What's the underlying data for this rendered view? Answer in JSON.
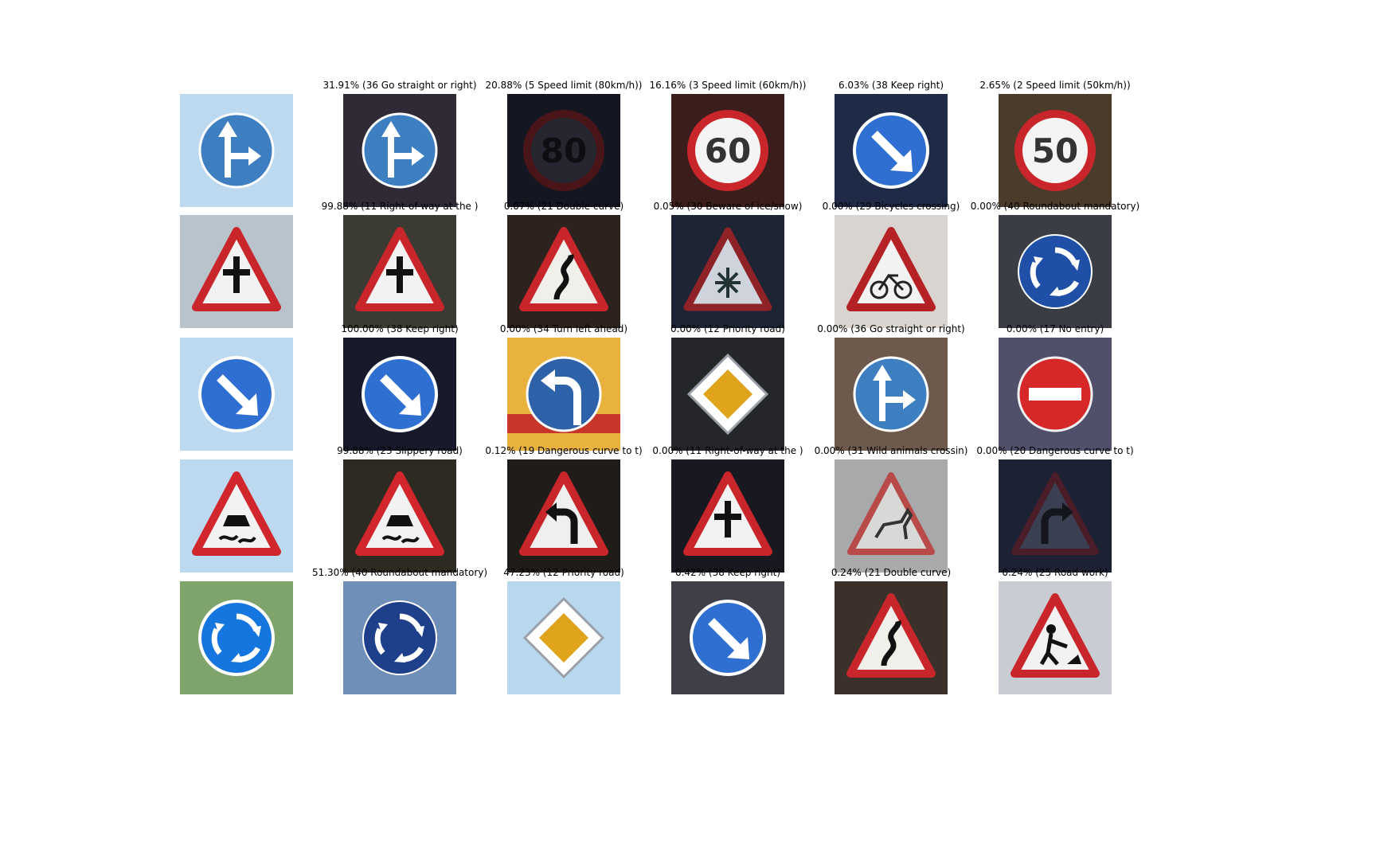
{
  "rows": [
    {
      "input": {
        "sign": "go-straight-or-right",
        "bg": "#bcd9f0",
        "style": "clean"
      },
      "preds": [
        {
          "label": "31.91% (36 Go straight or right)",
          "sign": "go-straight-or-right",
          "bg": "#2f2a35"
        },
        {
          "label": "20.88% (5 Speed limit (80km/h))",
          "sign": "speed-limit-dark",
          "text": "80",
          "bg": "#141621"
        },
        {
          "label": "16.16% (3 Speed limit (60km/h))",
          "sign": "speed-limit",
          "text": "60",
          "bg": "#3b1d1b"
        },
        {
          "label": "6.03% (38 Keep right)",
          "sign": "keep-right",
          "bg": "#1f2b46"
        },
        {
          "label": "2.65% (2 Speed limit (50km/h))",
          "sign": "speed-limit",
          "text": "50",
          "bg": "#4a3b2a"
        }
      ]
    },
    {
      "input": {
        "sign": "right-of-way",
        "bg": "#b9c3cc",
        "style": "clean"
      },
      "preds": [
        {
          "label": "99.88% (11 Right-of-way at the )",
          "sign": "right-of-way",
          "bg": "#3b3a33"
        },
        {
          "label": "0.07% (21 Double curve)",
          "sign": "double-curve",
          "bg": "#2d221d"
        },
        {
          "label": "0.05% (30 Beware of ice/snow)",
          "sign": "ice-snow",
          "bg": "#1d2433"
        },
        {
          "label": "0.00% (29 Bicycles crossing)",
          "sign": "bicycles",
          "bg": "#d9d4cf"
        },
        {
          "label": "0.00% (40 Roundabout mandatory)",
          "sign": "roundabout",
          "bg": "#3a3d44"
        }
      ]
    },
    {
      "input": {
        "sign": "keep-right",
        "bg": "#bcd9f0",
        "style": "clean"
      },
      "preds": [
        {
          "label": "100.00% (38 Keep right)",
          "sign": "keep-right",
          "bg": "#181a2b"
        },
        {
          "label": "0.00% (34 Turn left ahead)",
          "sign": "turn-left-ahead",
          "bg": "#e8b23c"
        },
        {
          "label": "0.00% (12 Priority road)",
          "sign": "priority-road",
          "bg": "#24262a"
        },
        {
          "label": "0.00% (36 Go straight or right)",
          "sign": "go-straight-or-right",
          "bg": "#6e5a4d"
        },
        {
          "label": "0.00% (17 No entry)",
          "sign": "no-entry",
          "bg": "#51506a"
        }
      ]
    },
    {
      "input": {
        "sign": "slippery-road",
        "bg": "#bcd9f0",
        "style": "clean"
      },
      "preds": [
        {
          "label": "99.88% (23 Slippery road)",
          "sign": "slippery-road",
          "bg": "#2d2a22"
        },
        {
          "label": "0.12% (19 Dangerous curve to t)",
          "sign": "curve-left",
          "bg": "#201c1a"
        },
        {
          "label": "0.00% (11 Right-of-way at the )",
          "sign": "right-of-way",
          "bg": "#181820"
        },
        {
          "label": "0.00% (31 Wild animals crossin)",
          "sign": "wild-animals",
          "bg": "#a8a9ab"
        },
        {
          "label": "0.00% (20 Dangerous curve to t)",
          "sign": "curve-right-dark",
          "bg": "#1c2133"
        }
      ]
    },
    {
      "input": {
        "sign": "roundabout-bright",
        "bg": "#7ea36b",
        "style": "clean"
      },
      "preds": [
        {
          "label": "51.30% (40 Roundabout mandatory)",
          "sign": "roundabout-dark",
          "bg": "#6f8fb8"
        },
        {
          "label": "47.23% (12 Priority road)",
          "sign": "priority-road",
          "bg": "#b8d8ee"
        },
        {
          "label": "0.42% (38 Keep right)",
          "sign": "keep-right",
          "bg": "#3e3f47"
        },
        {
          "label": "0.24% (21 Double curve)",
          "sign": "double-curve",
          "bg": "#3c302b"
        },
        {
          "label": "0.24% (25 Road work)",
          "sign": "road-work",
          "bg": "#c9ccd2"
        }
      ]
    }
  ]
}
